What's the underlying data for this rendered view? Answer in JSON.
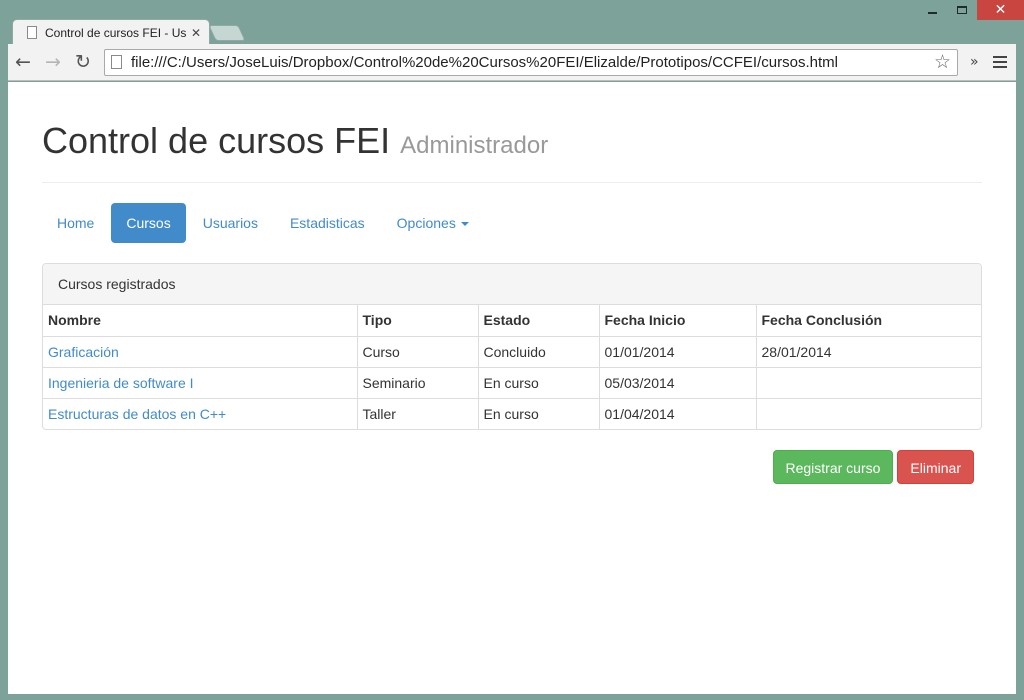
{
  "browser": {
    "tab_title": "Control de cursos FEI - Usuarios",
    "url": "file:///C:/Users/JoseLuis/Dropbox/Control%20de%20Cursos%20FEI/Elizalde/Prototipos/CCFEI/cursos.html"
  },
  "header": {
    "title": "Control de cursos FEI",
    "subtitle": "Administrador"
  },
  "nav": {
    "items": [
      "Home",
      "Cursos",
      "Usuarios",
      "Estadisticas",
      "Opciones"
    ],
    "active": "Cursos"
  },
  "panel": {
    "title": "Cursos registrados",
    "columns": [
      "Nombre",
      "Tipo",
      "Estado",
      "Fecha Inicio",
      "Fecha Conclusión"
    ],
    "rows": [
      [
        "Graficación",
        "Curso",
        "Concluido",
        "01/01/2014",
        "28/01/2014"
      ],
      [
        "Ingenieria de software I",
        "Seminario",
        "En curso",
        "05/03/2014",
        ""
      ],
      [
        "Estructuras de datos en C++",
        "Taller",
        "En curso",
        "01/04/2014",
        ""
      ]
    ]
  },
  "actions": {
    "register_label": "Registrar curso",
    "delete_label": "Eliminar"
  },
  "colors": {
    "primary": "#428bca",
    "success": "#5cb85c",
    "danger": "#d9534f"
  }
}
